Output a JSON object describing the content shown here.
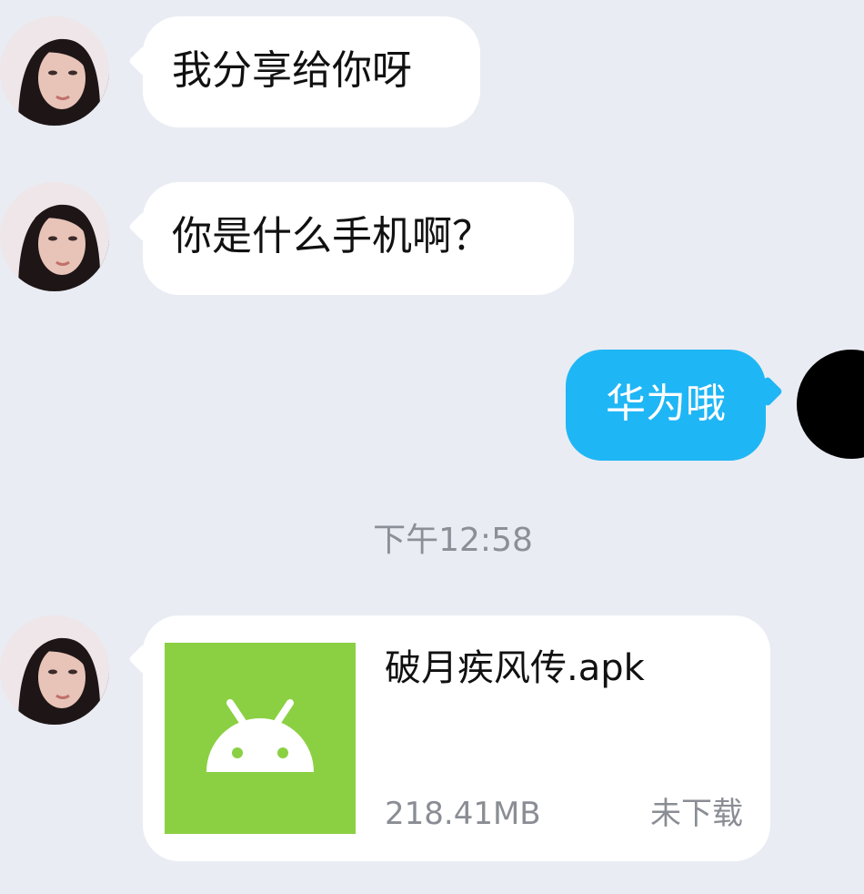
{
  "messages": [
    {
      "sender": "other",
      "text": "我分享给你呀"
    },
    {
      "sender": "other",
      "text": "你是什么手机啊？"
    },
    {
      "sender": "me",
      "text": "华为哦"
    }
  ],
  "timestamp": "下午12:58",
  "file_message": {
    "sender": "other",
    "file_name": "破月疾风传.apk",
    "file_size": "218.41MB",
    "status": "未下载",
    "icon": "android-icon"
  },
  "colors": {
    "background": "#e9ecf3",
    "incoming_bubble": "#ffffff",
    "outgoing_bubble": "#1fb6f5",
    "apk_icon_bg": "#8bd043",
    "meta_text": "#8a8d94"
  }
}
